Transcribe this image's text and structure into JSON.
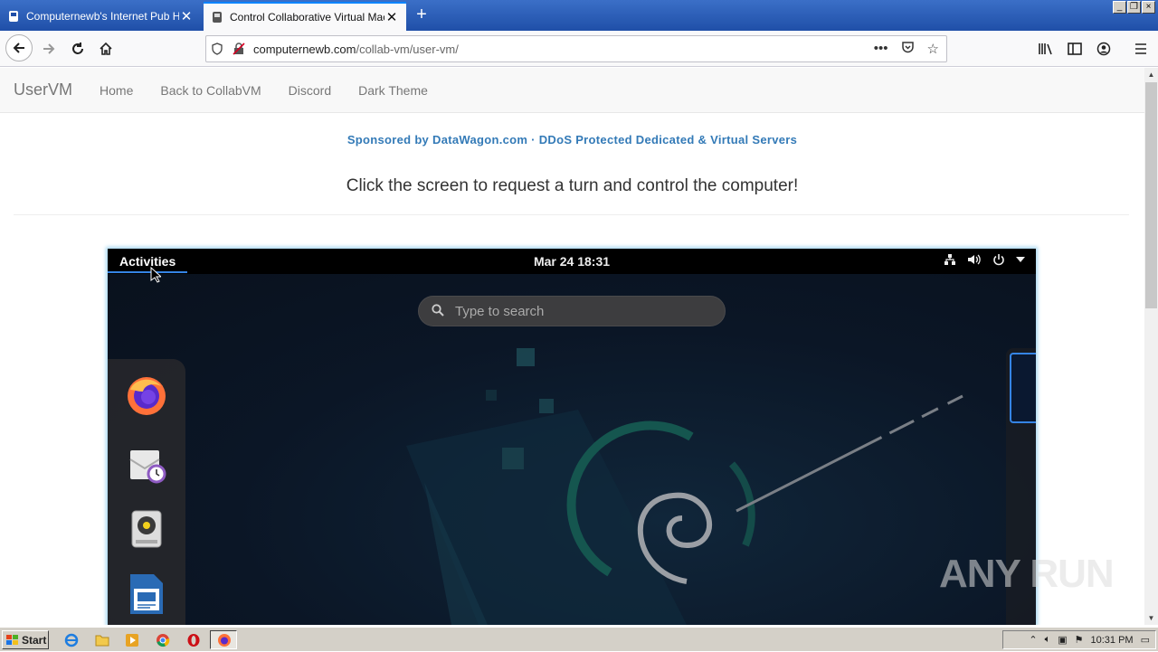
{
  "browser": {
    "tabs": [
      {
        "title": "Computernewb's Internet Pub Hub",
        "active": false
      },
      {
        "title": "Control Collaborative Virtual Machi",
        "active": true
      }
    ],
    "url_host": "computernewb.com",
    "url_path": "/collab-vm/user-vm/",
    "newtab_symbol": "+",
    "close_symbol": "✕"
  },
  "site": {
    "brand": "UserVM",
    "nav": [
      "Home",
      "Back to CollabVM",
      "Discord",
      "Dark Theme"
    ],
    "sponsor": "Sponsored by DataWagon.com · DDoS Protected Dedicated & Virtual Servers",
    "lead": "Click the screen to request a turn and control the computer!"
  },
  "vm": {
    "activities": "Activities",
    "clock": "Mar 24  18:31",
    "search_placeholder": "Type to search",
    "dock": [
      "firefox-icon",
      "evolution-mail-icon",
      "rhythmbox-icon",
      "libreoffice-writer-icon"
    ]
  },
  "taskbar": {
    "start": "Start",
    "time": "10:31 PM"
  },
  "watermark": "ANY RUN",
  "colors": {
    "accent": "#3584e4",
    "link": "#337ab7",
    "chrome_tab_blue": "#1f4fa8"
  }
}
